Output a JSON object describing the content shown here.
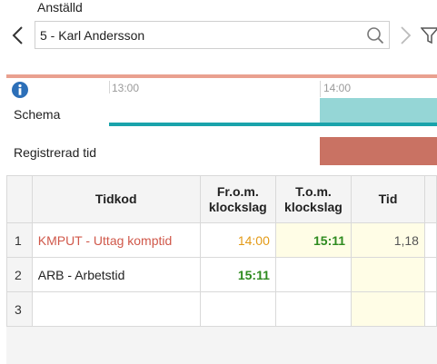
{
  "employee": {
    "label": "Anställd",
    "value": "5 - Karl Andersson"
  },
  "timeline": {
    "ticks": [
      "13:00",
      "14:00"
    ],
    "rows": {
      "schedule": "Schema",
      "registered": "Registrerad tid"
    }
  },
  "table": {
    "headers": {
      "code": "Tidkod",
      "from_line1": "Fr.o.m.",
      "from_line2": "klockslag",
      "to_line1": "T.o.m.",
      "to_line2": "klockslag",
      "time": "Tid"
    },
    "rows": [
      {
        "num": "1",
        "code": "KMPUT - Uttag komptid",
        "from": "14:00",
        "to": "15:11",
        "time": "1,18"
      },
      {
        "num": "2",
        "code": "ARB - Arbetstid",
        "from": "15:11",
        "to": "",
        "time": ""
      },
      {
        "num": "3",
        "code": "",
        "from": "",
        "to": "",
        "time": ""
      }
    ]
  },
  "colors": {
    "accent_red": "#d0584a",
    "from_orange": "#e39a17",
    "to_green": "#2e8b1f",
    "schedule_teal": "#1aa3ab"
  }
}
